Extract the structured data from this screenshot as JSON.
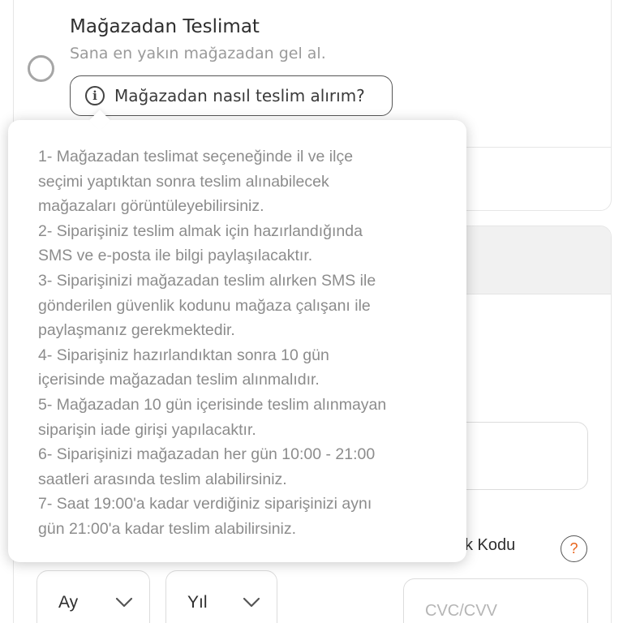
{
  "delivery_option": {
    "title": "Mağazadan Teslimat",
    "subtitle": "Sana en yakın mağazadan gel al.",
    "how_button_label": "Mağazadan nasıl teslim alırım?"
  },
  "tooltip": {
    "lines": [
      "1- Mağazadan teslimat seçeneğinde il ve ilçe",
      "seçimi yaptıktan sonra teslim alınabilecek",
      "mağazaları görüntüleyebilirsiniz.",
      "2- Siparişiniz teslim almak için hazırlandığında",
      "SMS ve e-posta ile bilgi paylaşılacaktır.",
      "3- Siparişinizi mağazadan teslim alırken SMS ile",
      "gönderilen güvenlik kodunu mağaza çalışanı ile",
      "paylaşmanız gerekmektedir.",
      "4- Siparişiniz hazırlandıktan sonra 10 gün",
      "içerisinde mağazadan teslim alınmalıdır.",
      "5- Mağazadan 10 gün içerisinde teslim alınmayan",
      "siparişin iade girişi yapılacaktır.",
      "6- Siparişinizi mağazadan her gün 10:00 - 21:00",
      "saatleri arasında teslim alabilirsiniz.",
      "7- Saat 19:00'a kadar verdiğiniz siparişinizi aynı",
      "gün 21:00'a kadar teslim alabilirsiniz."
    ]
  },
  "payment": {
    "security_code_label_partial": "k Kodu",
    "help_symbol": "?",
    "month_select": "Ay",
    "year_select": "Yıl",
    "cvc_placeholder": "CVC/CVV"
  },
  "colors": {
    "accent": "#e8631a",
    "muted_text": "#8c8c8c"
  }
}
